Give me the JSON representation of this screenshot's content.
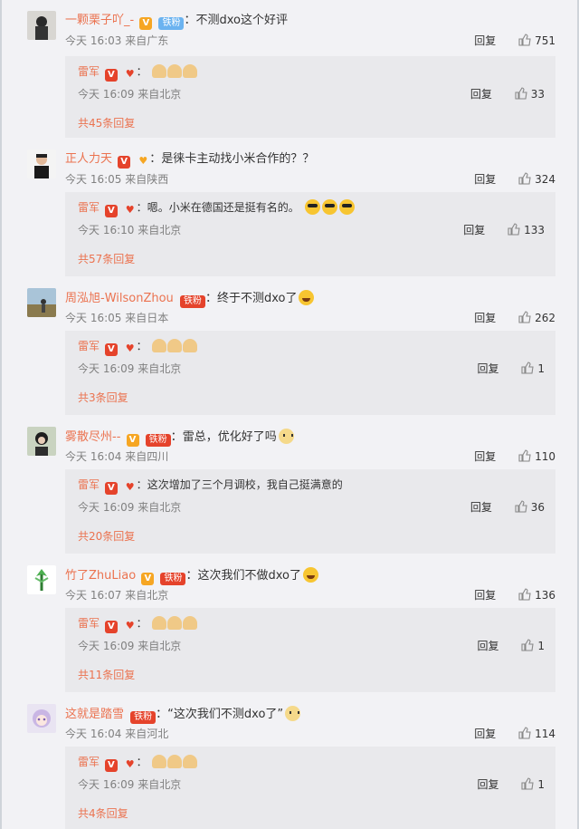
{
  "comments": [
    {
      "username": "一颗栗子吖_-",
      "fan_badge": "铁粉",
      "text": "不测dxo这个好评",
      "time": "今天 16:03",
      "location": "来自广东",
      "reply_label": "回复",
      "likes": "751",
      "reply": {
        "username": "雷军",
        "text": "",
        "time": "今天 16:09",
        "location": "来自北京",
        "reply_label": "回复",
        "likes": "33"
      },
      "more_replies": "共45条回复"
    },
    {
      "username": "正人力天",
      "text": "是徕卡主动找小米合作的？？",
      "time": "今天 16:05",
      "location": "来自陕西",
      "reply_label": "回复",
      "likes": "324",
      "reply": {
        "username": "雷军",
        "text": "嗯。小米在德国还是挺有名的。",
        "time": "今天 16:10",
        "location": "来自北京",
        "reply_label": "回复",
        "likes": "133"
      },
      "more_replies": "共57条回复"
    },
    {
      "username": "周泓旭-WilsonZhou",
      "fan_badge": "铁粉",
      "text": "终于不测dxo了",
      "time": "今天 16:05",
      "location": "来自日本",
      "reply_label": "回复",
      "likes": "262",
      "reply": {
        "username": "雷军",
        "text": "",
        "time": "今天 16:09",
        "location": "来自北京",
        "reply_label": "回复",
        "likes": "1"
      },
      "more_replies": "共3条回复"
    },
    {
      "username": "雾散尽州--",
      "fan_badge": "铁粉",
      "text": "雷总，优化好了吗",
      "time": "今天 16:04",
      "location": "来自四川",
      "reply_label": "回复",
      "likes": "110",
      "reply": {
        "username": "雷军",
        "text": "这次增加了三个月调校，我自己挺满意的",
        "time": "今天 16:09",
        "location": "来自北京",
        "reply_label": "回复",
        "likes": "36"
      },
      "more_replies": "共20条回复"
    },
    {
      "username": "竹了ZhuLiao",
      "fan_badge": "铁粉",
      "text": "这次我们不做dxo了",
      "time": "今天 16:07",
      "location": "来自北京",
      "reply_label": "回复",
      "likes": "136",
      "reply": {
        "username": "雷军",
        "text": "",
        "time": "今天 16:09",
        "location": "来自北京",
        "reply_label": "回复",
        "likes": "1"
      },
      "more_replies": "共11条回复"
    },
    {
      "username": "这就是踏雪",
      "fan_badge": "铁粉",
      "text": "“这次我们不测dxo了”",
      "time": "今天 16:04",
      "location": "来自河北",
      "reply_label": "回复",
      "likes": "114",
      "reply": {
        "username": "雷军",
        "text": "",
        "time": "今天 16:09",
        "location": "来自北京",
        "reply_label": "回复",
        "likes": "1"
      },
      "more_replies": "共4条回复"
    }
  ],
  "colors": {
    "username": "#eb7350",
    "meta": "#808080",
    "reply_bg": "#e9e9ec",
    "page_bg": "#f2f2f5"
  },
  "icons": {
    "like": "thumbs-up-icon",
    "verified": "v-badge-icon",
    "heart": "heart-icon"
  },
  "v_badge_glyph": "V",
  "heart_glyph": "♥",
  "colon": "："
}
